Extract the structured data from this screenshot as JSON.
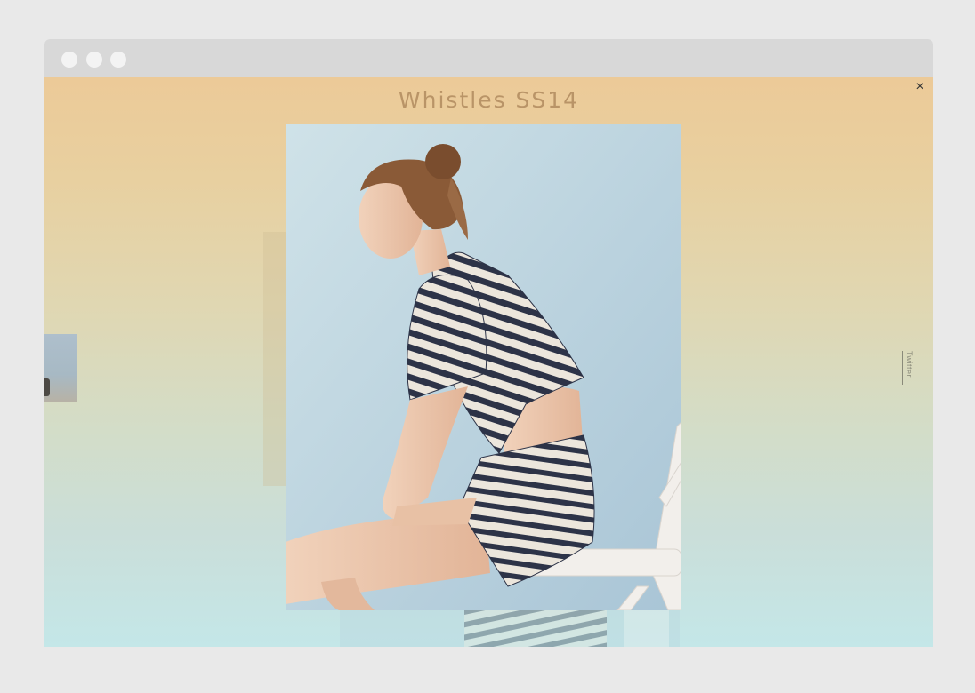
{
  "gallery": {
    "title": "Whistles SS14",
    "close_label": "×",
    "share_link": "Twitter"
  },
  "colors": {
    "chrome_bar": "#d8d8d8",
    "gradient_top": "#ecca98",
    "gradient_bottom": "#c4e7e8",
    "title_color": "#b99467"
  },
  "icons": {
    "close": "close-icon",
    "window_dots": [
      "window-dot",
      "window-dot",
      "window-dot"
    ]
  }
}
